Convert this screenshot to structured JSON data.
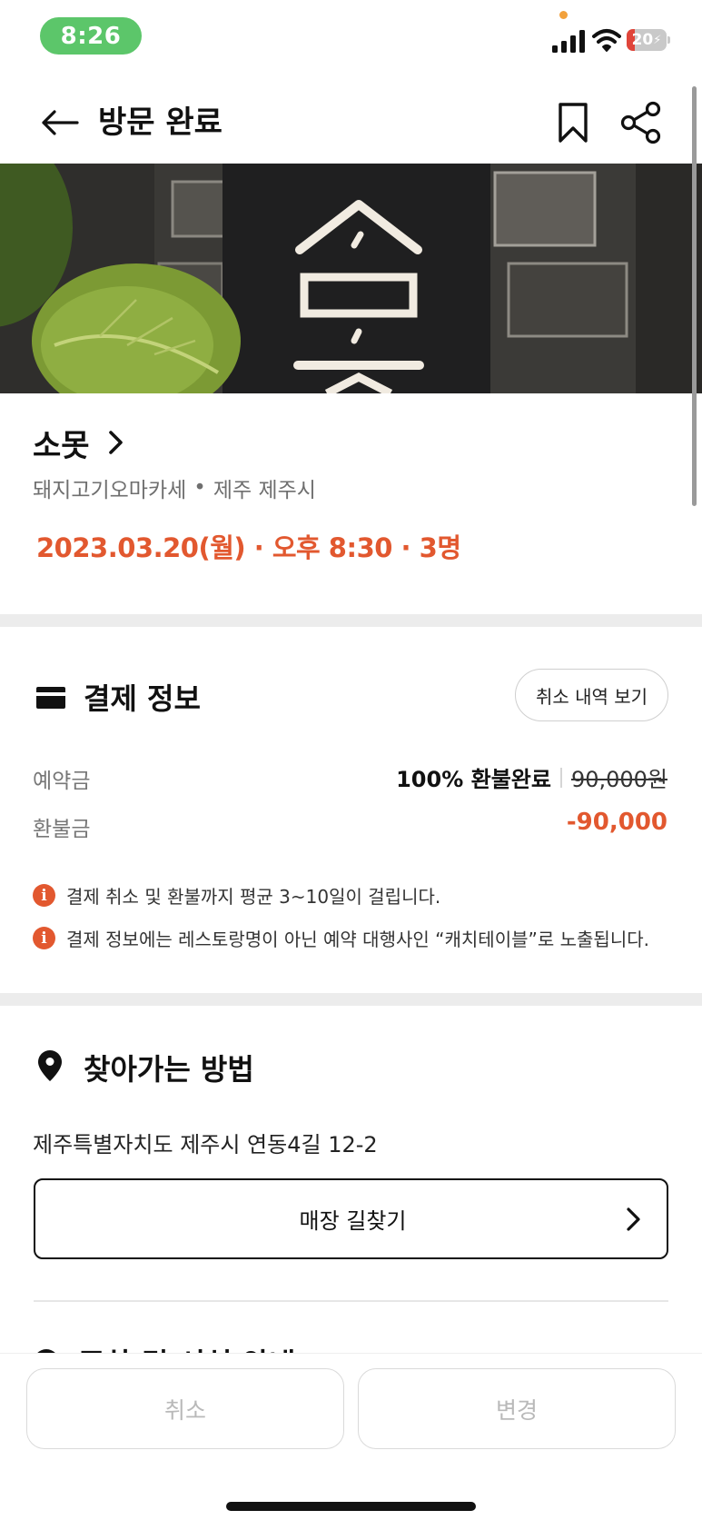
{
  "status_bar": {
    "time": "8:26",
    "battery_level": "20",
    "battery_fraction": 0.2
  },
  "header": {
    "title": "방문 완료"
  },
  "restaurant": {
    "name": "소못",
    "category": "돼지고기오마카세",
    "separator": "•",
    "location": "제주 제주시",
    "booking_info": "2023.03.20(월) · 오후 8:30 · 3명"
  },
  "payment": {
    "title": "결제 정보",
    "cancel_history_label": "취소 내역 보기",
    "deposit_label": "예약금",
    "deposit_status": "100% 환불완료",
    "deposit_amount": "90,000원",
    "refund_label": "환불금",
    "refund_amount": "-90,000",
    "notices": [
      "결제 취소 및 환불까지 평균 3~10일이 걸립니다.",
      "결제 정보에는 레스토랑명이 아닌 예약 대행사인 “캐치테이블”로 노출됩니다."
    ]
  },
  "directions": {
    "title": "찾아가는 방법",
    "address": "제주특별자치도 제주시 연동4길 12-2",
    "button_label": "매장 길찾기"
  },
  "next_section": {
    "title": "주차 및 시설 안내"
  },
  "bottom_actions": {
    "cancel_label": "취소",
    "change_label": "변경"
  },
  "colors": {
    "accent": "#e2582f",
    "status_pill": "#5cc66a",
    "divider": "#ececec"
  }
}
